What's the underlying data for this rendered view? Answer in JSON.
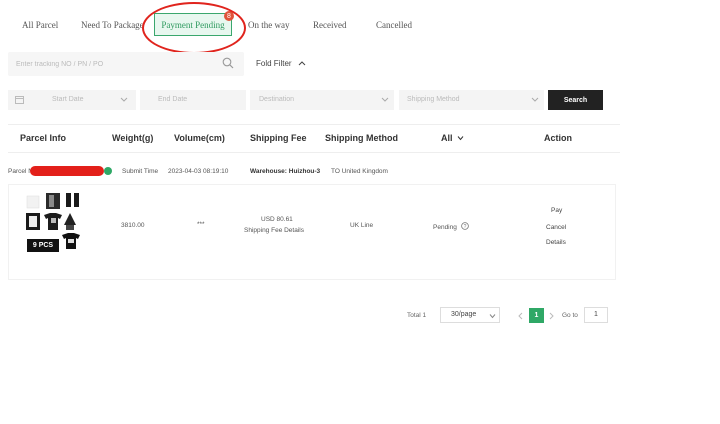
{
  "tabs": {
    "all": "All Parcel",
    "need": "Need To Package",
    "pending": "Payment Pending",
    "pending_badge": "8",
    "way": "On the way",
    "received": "Received",
    "cancelled": "Cancelled"
  },
  "search": {
    "placeholder": "Enter tracking NO / PN / PO",
    "fold_label": "Fold Filter"
  },
  "filters": {
    "start_date": "Start Date",
    "end_date": "End Date",
    "destination": "Destination",
    "shipping_method": "Shipping Method",
    "search_label": "Search"
  },
  "table": {
    "headers": {
      "parcel_info": "Parcel Info",
      "weight": "Weight(g)",
      "volume": "Volume(cm)",
      "fee": "Shipping Fee",
      "method": "Shipping Method",
      "status": "All",
      "action": "Action"
    }
  },
  "parcel": {
    "no_label": "Parcel No:",
    "submit_label": "Submit Time",
    "submit_time": "2023-04-03 08:19:10",
    "warehouse_label": "Warehouse: Huizhou-3",
    "warehouse_dest": "TO United Kingdom",
    "pcs": "9 PCS",
    "weight": "3810.00",
    "volume": "***",
    "fee": "USD 80.61",
    "fee_details": "Shipping Fee Details",
    "method": "UK Line",
    "status": "Pending",
    "actions": {
      "pay": "Pay",
      "cancel": "Cancel",
      "details": "Details"
    }
  },
  "pagination": {
    "total": "Total 1",
    "page_size": "30/page",
    "current": "1",
    "goto_label": "Go to",
    "goto_value": "1"
  },
  "colors": {
    "accent": "#2fa866",
    "annotation": "#e0241d"
  }
}
